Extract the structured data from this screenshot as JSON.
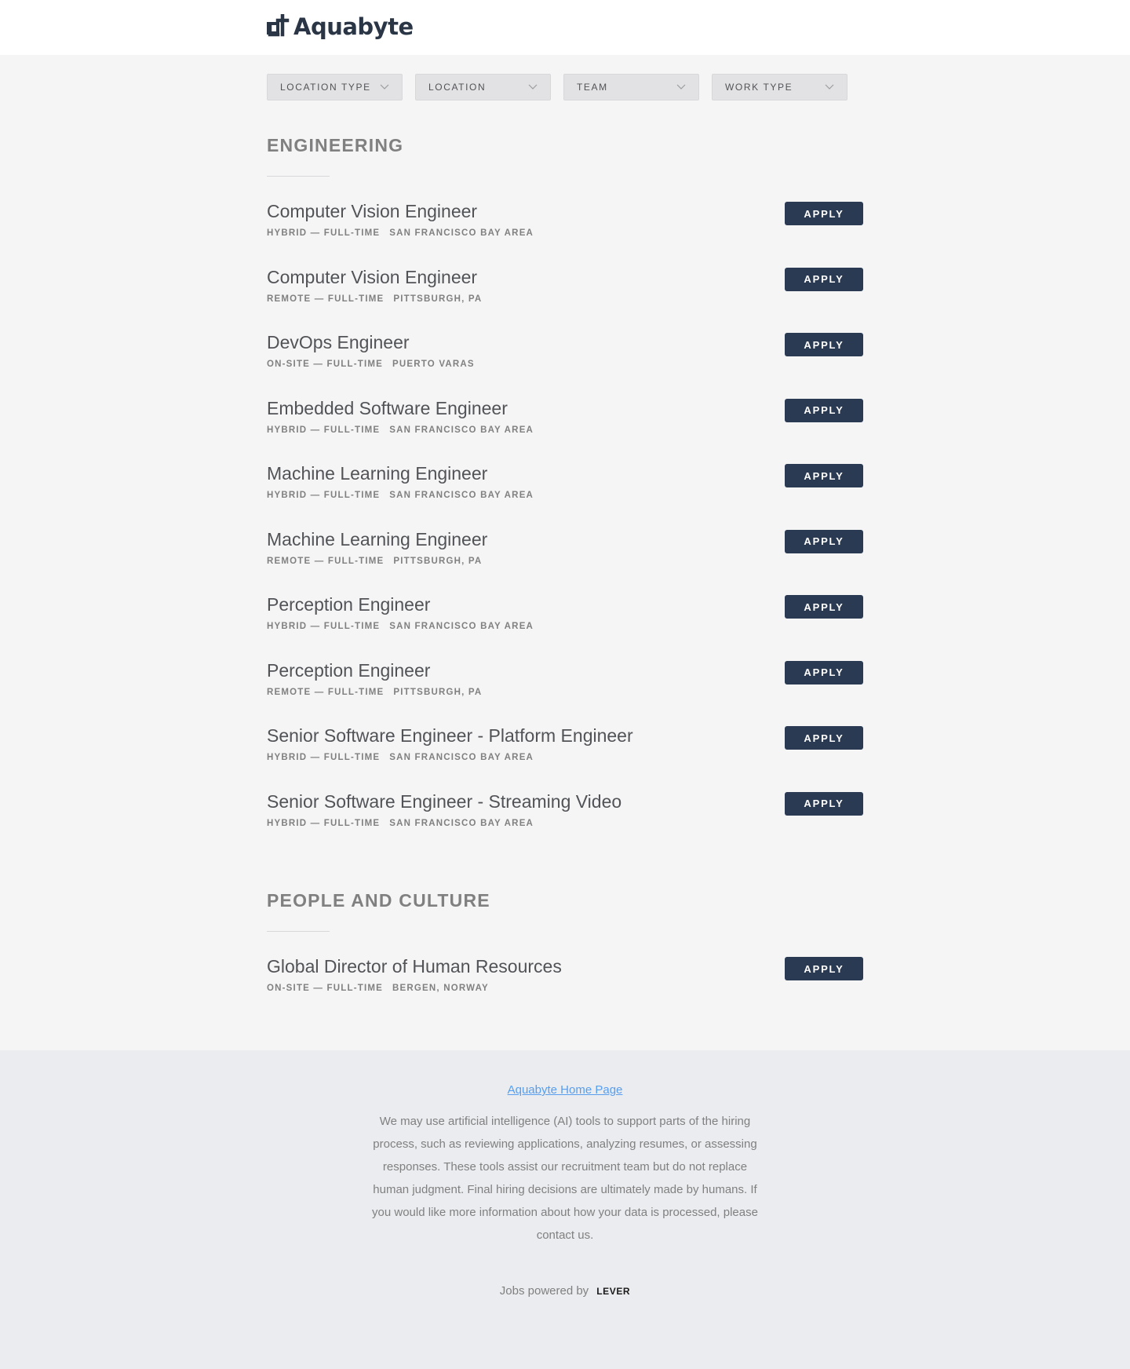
{
  "brand": {
    "name": "Aquabyte",
    "logo_icon": "aquabyte-logo-icon",
    "color": "#2a3646"
  },
  "filters": [
    {
      "label": "LOCATION TYPE",
      "icon": "chevron-down-icon"
    },
    {
      "label": "LOCATION",
      "icon": "chevron-down-icon"
    },
    {
      "label": "TEAM",
      "icon": "chevron-down-icon"
    },
    {
      "label": "WORK TYPE",
      "icon": "chevron-down-icon"
    }
  ],
  "sections": [
    {
      "title": "ENGINEERING",
      "postings": [
        {
          "title": "Computer Vision Engineer",
          "commitment": "HYBRID — FULL-TIME",
          "location": "SAN FRANCISCO BAY AREA",
          "apply": "APPLY"
        },
        {
          "title": "Computer Vision Engineer",
          "commitment": "REMOTE — FULL-TIME",
          "location": "PITTSBURGH, PA",
          "apply": "APPLY"
        },
        {
          "title": "DevOps Engineer",
          "commitment": "ON-SITE — FULL-TIME",
          "location": "PUERTO VARAS",
          "apply": "APPLY"
        },
        {
          "title": "Embedded Software Engineer",
          "commitment": "HYBRID — FULL-TIME",
          "location": "SAN FRANCISCO BAY AREA",
          "apply": "APPLY"
        },
        {
          "title": "Machine Learning Engineer",
          "commitment": "HYBRID — FULL-TIME",
          "location": "SAN FRANCISCO BAY AREA",
          "apply": "APPLY"
        },
        {
          "title": "Machine Learning Engineer",
          "commitment": "REMOTE — FULL-TIME",
          "location": "PITTSBURGH, PA",
          "apply": "APPLY"
        },
        {
          "title": "Perception Engineer",
          "commitment": "HYBRID — FULL-TIME",
          "location": "SAN FRANCISCO BAY AREA",
          "apply": "APPLY"
        },
        {
          "title": "Perception Engineer",
          "commitment": "REMOTE — FULL-TIME",
          "location": "PITTSBURGH, PA",
          "apply": "APPLY"
        },
        {
          "title": "Senior Software Engineer - Platform Engineer",
          "commitment": "HYBRID — FULL-TIME",
          "location": "SAN FRANCISCO BAY AREA",
          "apply": "APPLY"
        },
        {
          "title": "Senior Software Engineer - Streaming Video",
          "commitment": "HYBRID — FULL-TIME",
          "location": "SAN FRANCISCO BAY AREA",
          "apply": "APPLY"
        }
      ]
    },
    {
      "title": "PEOPLE AND CULTURE",
      "postings": [
        {
          "title": "Global Director of Human Resources",
          "commitment": "ON-SITE — FULL-TIME",
          "location": "BERGEN, NORWAY",
          "apply": "APPLY"
        }
      ]
    }
  ],
  "footer": {
    "home_link": "Aquabyte Home Page",
    "disclaimer": "We may use artificial intelligence (AI) tools to support parts of the hiring process, such as reviewing applications, analyzing resumes, or assessing responses. These tools assist our recruitment team but do not replace human judgment. Final hiring decisions are ultimately made by humans. If you would like more information about how your data is processed, please contact us.",
    "powered_text": "Jobs powered by",
    "powered_brand": "LEVER"
  },
  "colors": {
    "apply_button": "#2a3a53",
    "link": "#579eee",
    "page_bg": "#f5f5f6",
    "footer_bg": "#ebecef"
  }
}
